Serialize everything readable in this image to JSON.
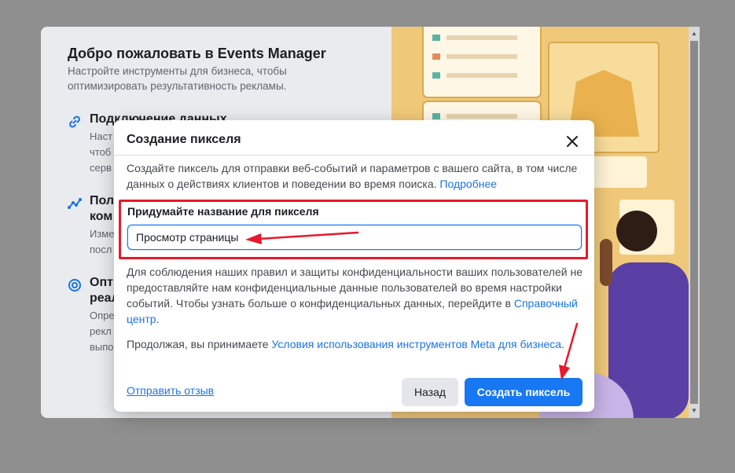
{
  "background": {
    "title": "Добро пожаловать в Events Manager",
    "subtitle": "Настройте инструменты для бизнеса, чтобы оптимизировать результативность рекламы.",
    "features": [
      {
        "icon": "link-icon",
        "title": "Подключение данных",
        "desc_lines": [
          "Наст",
          "чтоб",
          "серв"
        ]
      },
      {
        "icon": "graph-nodes-icon",
        "title_lines": [
          "Пол",
          "ком"
        ],
        "desc_lines": [
          "Изме",
          "посл"
        ]
      },
      {
        "icon": "target-icon",
        "title_lines": [
          "Опт",
          "реал"
        ],
        "desc_lines": [
          "Опре",
          "рекл",
          "выпо"
        ]
      }
    ]
  },
  "dialog": {
    "title": "Создание пикселя",
    "description": "Создайте пиксель для отправки веб-событий и параметров с вашего сайта, в том числе данных о действиях клиентов и поведении во время поиска.",
    "learn_more": "Подробнее",
    "field_label": "Придумайте название для пикселя",
    "field_value": "Просмотр страницы",
    "privacy_text": "Для соблюдения наших правил и защиты конфиденциальности ваших пользователей не предоставляйте нам конфиденциальные данные пользователей во время настройки событий. Чтобы узнать больше о конфиденциальных данных, перейдите в",
    "privacy_link": "Справочный центр",
    "privacy_end": ".",
    "terms_text": "Продолжая, вы принимаете",
    "terms_link": "Условия использования инструментов Meta для бизнеса",
    "terms_end": ".",
    "feedback_link": "Отправить отзыв",
    "back_button": "Назад",
    "create_button": "Создать пиксель"
  },
  "colors": {
    "primary": "#1877f2",
    "link": "#1b74e4",
    "annotation": "#e8192c"
  }
}
